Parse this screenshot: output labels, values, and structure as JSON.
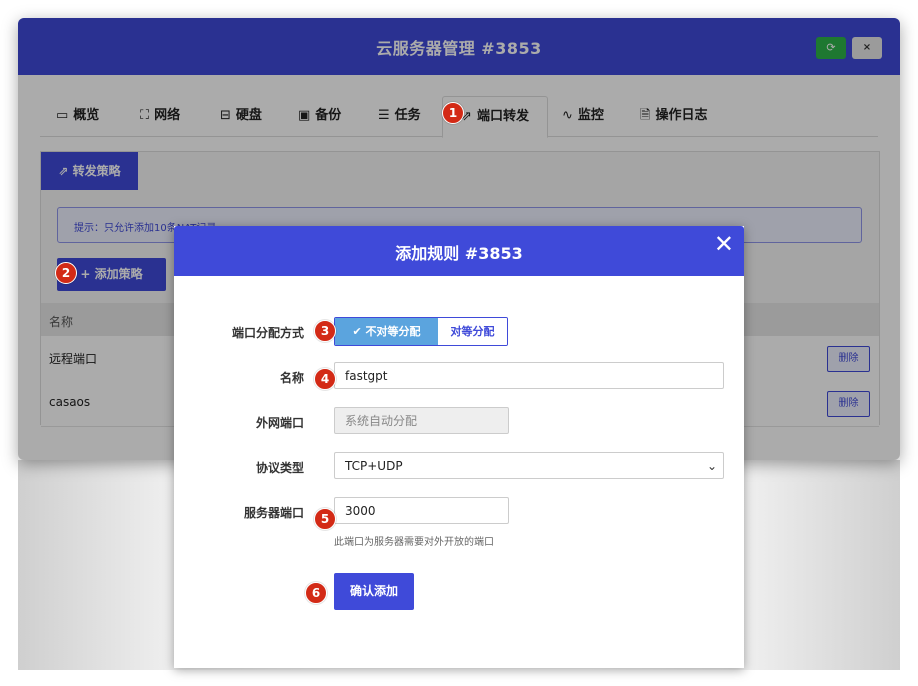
{
  "window": {
    "title": "云服务器管理 #3853",
    "refresh_icon": "⟳",
    "close_icon": "×"
  },
  "tabs": [
    {
      "icon": "monitor-icon",
      "glyph": "▭",
      "label": "概览"
    },
    {
      "icon": "network-icon",
      "glyph": "⛶",
      "label": "网络"
    },
    {
      "icon": "disk-icon",
      "glyph": "⊟",
      "label": "硬盘"
    },
    {
      "icon": "save-icon",
      "glyph": "▣",
      "label": "备份"
    },
    {
      "icon": "tasks-icon",
      "glyph": "☰",
      "label": "任务"
    },
    {
      "icon": "external-link-icon",
      "glyph": "⇗",
      "label": "端口转发"
    },
    {
      "icon": "pulse-icon",
      "glyph": "∿",
      "label": "监控"
    },
    {
      "icon": "file-icon",
      "glyph": "🗎",
      "label": "操作日志"
    }
  ],
  "panel": {
    "tab_label": "转发策略",
    "tab_glyph": "⇗",
    "tip": "提示：只允许添加10条NAT记录",
    "add_button": "添加策略",
    "add_glyph": "+",
    "column_name": "名称",
    "rows": [
      {
        "name": "远程端口",
        "action": "删除"
      },
      {
        "name": "casaos",
        "action": "删除"
      }
    ]
  },
  "modal": {
    "title": "添加规则 #3853",
    "close_glyph": "✕",
    "alloc_label": "端口分配方式",
    "alloc_options": [
      "不对等分配",
      "对等分配"
    ],
    "alloc_selected": "不对等分配",
    "check_glyph": "✔",
    "name_label": "名称",
    "name_value": "fastgpt",
    "external_port_label": "外网端口",
    "external_port_placeholder": "系统自动分配",
    "protocol_label": "协议类型",
    "protocol_value": "TCP+UDP",
    "server_port_label": "服务器端口",
    "server_port_value": "3000",
    "server_port_hint": "此端口为服务器需要对外开放的端口",
    "submit_label": "确认添加"
  },
  "steps": [
    "1",
    "2",
    "3",
    "4",
    "5",
    "6"
  ],
  "colors": {
    "primary": "#3f4ad9",
    "toggle_active": "#5ba4de",
    "step_marker": "#d32a16",
    "refresh_button": "#2db34a"
  }
}
